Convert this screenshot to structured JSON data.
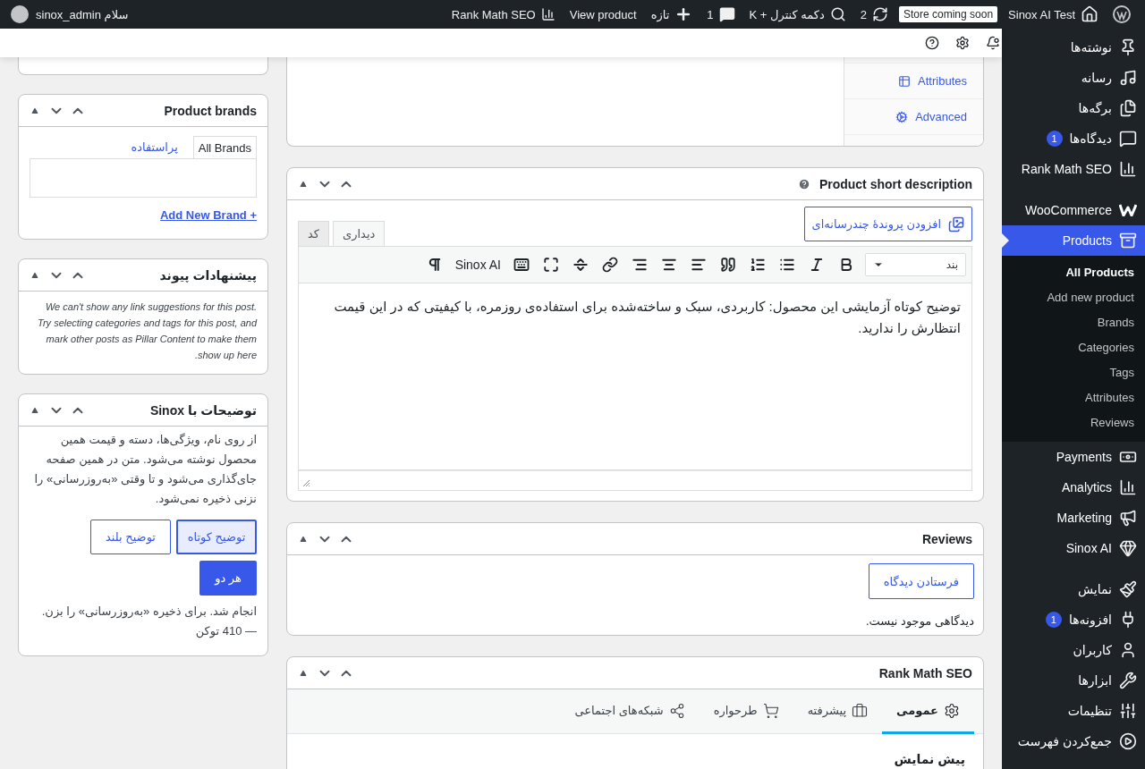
{
  "admin_bar": {
    "site_title": "Sinox AI Test",
    "store_badge": "Store coming soon",
    "updates_count": "2",
    "search_label": "دکمه کنترل + K",
    "comments_count": "1",
    "new_label": "تازه",
    "view_product": "View product",
    "rank_math": "Rank Math SEO",
    "greeting": "سلام sinox_admin"
  },
  "product_data": {
    "tabs": [
      {
        "label": "Attributes"
      },
      {
        "label": "Advanced"
      }
    ]
  },
  "short_description": {
    "title": "Product short description",
    "add_media": "افزودن پروندهٔ چندرسانه‌ای",
    "editor_tabs": [
      {
        "label": "دیداری",
        "selected": true
      },
      {
        "label": "کد",
        "selected": false
      }
    ],
    "format": "بند",
    "sinox_button": "Sinox AI",
    "content": "توضیح کوتاه آزمایشی این محصول: کاربردی، سبک و ساخته‌شده برای استفاده‌ی روزمره، با کیفیتی که در این قیمت انتظارش را ندارید."
  },
  "reviews": {
    "title": "Reviews",
    "add_button": "فرستادن دیدگاه",
    "empty_text": "دیدگاهی موجود نیست."
  },
  "rank_math": {
    "title": "Rank Math SEO",
    "tabs": [
      {
        "label": "عمومی",
        "selected": true
      },
      {
        "label": "پیشرفته",
        "selected": false
      },
      {
        "label": "طرحواره",
        "selected": false
      },
      {
        "label": "شبکه‌های اجتماعی",
        "selected": false
      }
    ],
    "section_title": "پیش نمایش"
  },
  "brands": {
    "title": "Product brands",
    "tabs": [
      {
        "label": "All Brands",
        "selected": true
      },
      {
        "label": "پراستفاده",
        "selected": false
      }
    ],
    "add_link": "+ Add New Brand"
  },
  "link_suggestions": {
    "title": "پیشنهادات پیوند",
    "message": "We can't show any link suggestions for this post. Try selecting categories and tags for this post, and mark other posts as Pillar Content to make them show up here."
  },
  "sinox": {
    "title": "توضیحات با Sinox",
    "description": "از روی نام، ویژگی‌ها، دسته و قیمت همین محصول نوشته می‌شود. متن در همین صفحه جای‌گذاری می‌شود و تا وقتی «به‌روزرسانی» را نزنی ذخیره نمی‌شود.",
    "options": [
      {
        "label": "توضیح کوتاه",
        "selected": true
      },
      {
        "label": "توضیح بلند",
        "selected": false
      }
    ],
    "generate_button": "هر دو",
    "status": "انجام شد. برای ذخیره «به‌روزرسانی» را بزن. — 410 توکن"
  },
  "menu": {
    "groups": [
      {
        "items": [
          {
            "label": "نوشته‌ها",
            "selected": false
          },
          {
            "label": "رسانه",
            "selected": false
          },
          {
            "label": "برگه‌ها",
            "selected": false
          },
          {
            "label": "دیدگاه‌ها",
            "badge": "1",
            "selected": false
          },
          {
            "label": "Rank Math SEO",
            "selected": false
          }
        ]
      },
      {
        "items": [
          {
            "label": "WooCommerce",
            "selected": false
          },
          {
            "label": "Products",
            "selected": true,
            "children": [
              {
                "label": "All Products",
                "selected": true
              },
              {
                "label": "Add new product",
                "selected": false
              },
              {
                "label": "Brands",
                "selected": false
              },
              {
                "label": "Categories",
                "selected": false
              },
              {
                "label": "Tags",
                "selected": false
              },
              {
                "label": "Attributes",
                "selected": false
              },
              {
                "label": "Reviews",
                "selected": false
              }
            ]
          },
          {
            "label": "Payments",
            "selected": false
          },
          {
            "label": "Analytics",
            "selected": false
          },
          {
            "label": "Marketing",
            "selected": false
          },
          {
            "label": "Sinox AI",
            "selected": false
          }
        ]
      },
      {
        "items": [
          {
            "label": "نمایش",
            "selected": false
          },
          {
            "label": "افزونه‌ها",
            "badge": "1",
            "selected": false
          },
          {
            "label": "کاربران",
            "selected": false
          },
          {
            "label": "ابزارها",
            "selected": false
          },
          {
            "label": "تنظیمات",
            "selected": false
          },
          {
            "label": "جمع‌کردن فهرست",
            "selected": false
          }
        ]
      }
    ]
  }
}
